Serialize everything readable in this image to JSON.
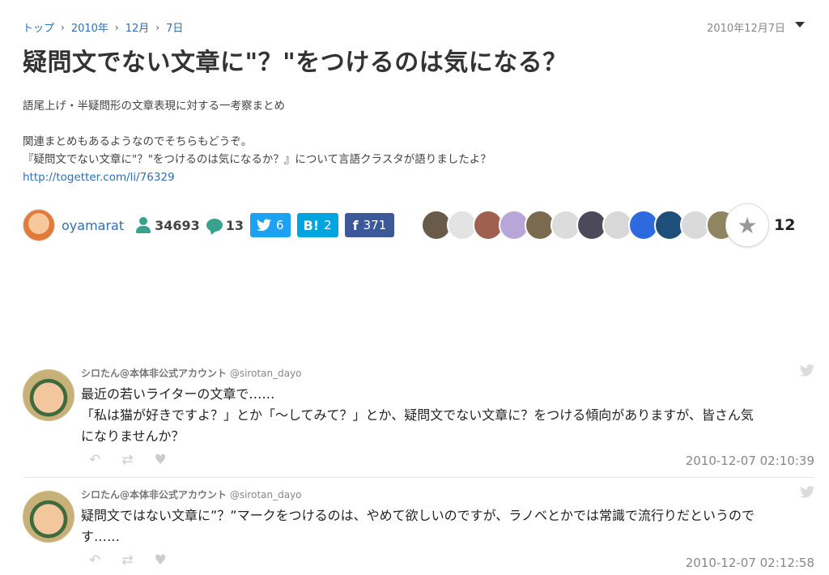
{
  "breadcrumb": {
    "home": "トップ",
    "year": "2010年",
    "month": "12月",
    "day": "7日"
  },
  "header_date": "2010年12月7日",
  "title": "疑問文でない文章に\"？\"をつけるのは気になる？",
  "description": {
    "line1": "語尾上げ・半疑問形の文章表現に対する一考察まとめ",
    "line2": "関連まとめもあるようなのでそちらもどうぞ。",
    "line3": "『疑問文でない文章に\"？\"をつけるのは気になるか？』について言語クラスタが語りましたよ？",
    "link": "http://togetter.com/li/76329"
  },
  "author": {
    "name": "oyamarat",
    "views": "34693",
    "comments": "13"
  },
  "share": {
    "twitter_count": "6",
    "hatena_logo": "B!",
    "hatena_count": "2",
    "facebook_logo": "f",
    "facebook_count": "371"
  },
  "favorites": {
    "count": "12",
    "avatar_colors": [
      "#6a5a4a",
      "#e3e3e3",
      "#a06050",
      "#b8a6d8",
      "#7a6a4e",
      "#dcdcdc",
      "#4a4a5a",
      "#d8d8d8",
      "#2d6ae0",
      "#1d4f7a",
      "#dadada",
      "#8f8560"
    ]
  },
  "tweets": [
    {
      "display_name": "シロたん@本体非公式アカウント",
      "handle": "@sirotan_dayo",
      "lines": [
        "最近の若いライターの文章で……",
        "「私は猫が好きですよ？」とか「〜してみて？」とか、疑問文でない文章に？をつける傾向がありますが、皆さん気",
        "になりませんか？"
      ],
      "timestamp": "2010-12-07 02:10:39"
    },
    {
      "display_name": "シロたん@本体非公式アカウント",
      "handle": "@sirotan_dayo",
      "lines": [
        "疑問文ではない文章に”？”マークをつけるのは、やめて欲しいのですが、ラノベとかでは常識で流行りだというので",
        "す……"
      ],
      "timestamp": "2010-12-07 02:12:58"
    }
  ]
}
